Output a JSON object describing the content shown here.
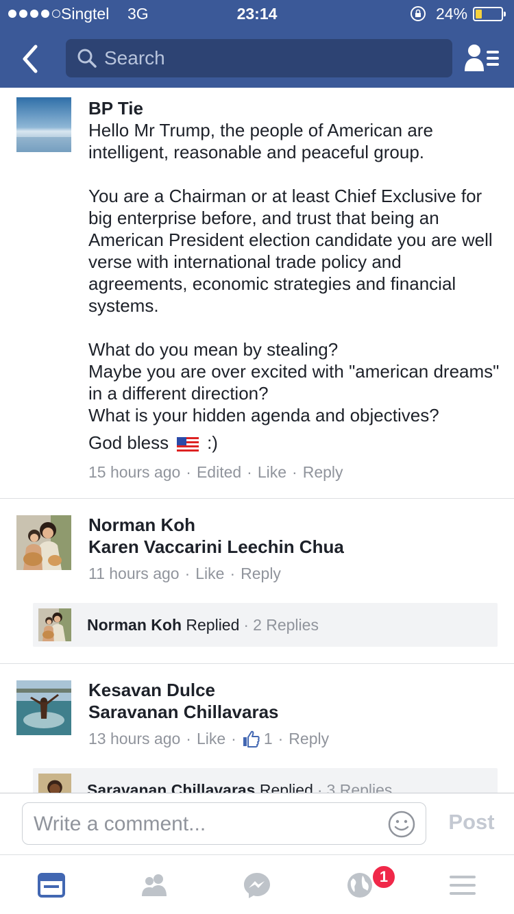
{
  "status": {
    "carrier": "Singtel",
    "network": "3G",
    "time": "23:14",
    "battery_percent": "24%",
    "battery_level": 0.24,
    "signal_bars": 4
  },
  "nav": {
    "search_placeholder": "Search"
  },
  "comments": [
    {
      "author": "BP Tie",
      "paragraphs": [
        "Hello Mr Trump, the people of American are intelligent, reasonable and peaceful group.",
        "You are a Chairman or at least Chief Exclusive for big enterprise before,  and trust that being an American President election candidate you are well verse with international trade policy and agreements, economic strategies and financial systems.",
        "What do you mean by stealing?\nMaybe you are over excited with \"american dreams\" in a different direction?\nWhat is your hidden agenda and objectives?"
      ],
      "closing_text": "God bless",
      "closing_emoji": "flag-us",
      "closing_after": ":)",
      "time": "15 hours ago",
      "edited": "Edited",
      "like": "Like",
      "reply": "Reply"
    },
    {
      "author": "Norman Koh",
      "mention": "Karen Vaccarini Leechin Chua",
      "time": "11 hours ago",
      "like": "Like",
      "reply": "Reply",
      "reply_summary": {
        "name": "Norman Koh",
        "label": "Replied",
        "count": "2 Replies"
      }
    },
    {
      "author": "Kesavan Dulce",
      "mention": "Saravanan Chillavaras",
      "time": "13 hours ago",
      "like": "Like",
      "like_count": "1",
      "reply": "Reply",
      "reply_summary": {
        "name": "Saravanan Chillavaras",
        "label": "Replied",
        "count": "3 Replies"
      }
    }
  ],
  "composer": {
    "placeholder": "Write a comment...",
    "post_label": "Post"
  },
  "tabbar": {
    "notification_badge": "1"
  },
  "colors": {
    "brand": "#3b5998",
    "meta": "#90949c",
    "badge": "#f02849",
    "active_tab": "#4267b2"
  }
}
